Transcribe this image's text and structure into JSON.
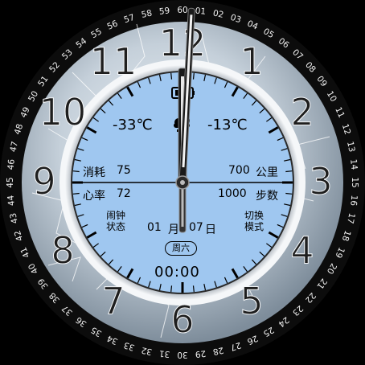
{
  "face": {
    "hour_numerals": [
      "12",
      "1",
      "2",
      "3",
      "4",
      "5",
      "6",
      "7",
      "8",
      "9",
      "10",
      "11"
    ],
    "minute_ring_labels": [
      "60",
      "01",
      "02",
      "03",
      "04",
      "05",
      "06",
      "07",
      "08",
      "09",
      "10",
      "11",
      "12",
      "13",
      "14",
      "15",
      "16",
      "17",
      "18",
      "19",
      "20",
      "21",
      "22",
      "23",
      "24",
      "25",
      "26",
      "27",
      "28",
      "29",
      "30",
      "31",
      "32",
      "33",
      "34",
      "35",
      "36",
      "37",
      "38",
      "39",
      "40",
      "41",
      "42",
      "43",
      "44",
      "45",
      "46",
      "47",
      "48",
      "49",
      "50",
      "51",
      "52",
      "53",
      "54",
      "55",
      "56",
      "57",
      "58",
      "59"
    ],
    "colors": {
      "dial_fill": "#9fc7f0",
      "ice": "#c9d3dc",
      "bezel": "#111111",
      "ring_text": "#f2f2f2",
      "hand": "#1a1a1a"
    }
  },
  "weather": {
    "temp_low": "-33℃",
    "temp_high": "-13℃",
    "icon": "weather-icon"
  },
  "stats": {
    "consumption_label": "消耗",
    "consumption_value": "75",
    "distance_value": "700",
    "distance_unit": "公里",
    "heart_label": "心率",
    "heart_value": "72",
    "steps_value": "1000",
    "steps_unit": "步数"
  },
  "buttons": {
    "alarm_line1": "闹钟",
    "alarm_line2": "状态",
    "mode_line1": "切换",
    "mode_line2": "模式"
  },
  "date": {
    "month": "01",
    "month_unit": "月",
    "day": "07",
    "day_unit": "日",
    "weekday": "周六"
  },
  "digital_time": "00:00",
  "time_shown": {
    "hour": 12,
    "minute": 0,
    "second": 30
  },
  "icons": {
    "top_indicator": "battery-icon"
  }
}
